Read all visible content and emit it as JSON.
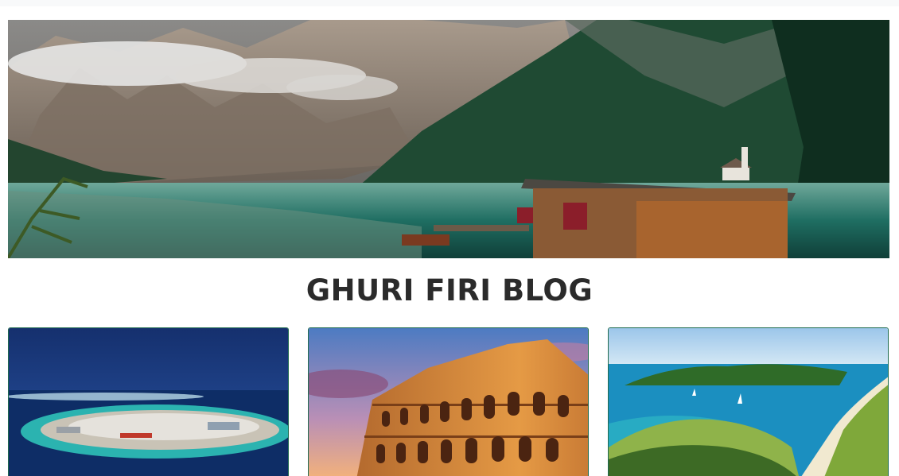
{
  "blog": {
    "title": "GHURI FIRI BLOG"
  },
  "hero": {
    "image": "mountain-lake-boathouse"
  },
  "cards": [
    {
      "image": "island-city-aerial"
    },
    {
      "image": "colosseum-sunset"
    },
    {
      "image": "green-bay-coastline"
    }
  ]
}
